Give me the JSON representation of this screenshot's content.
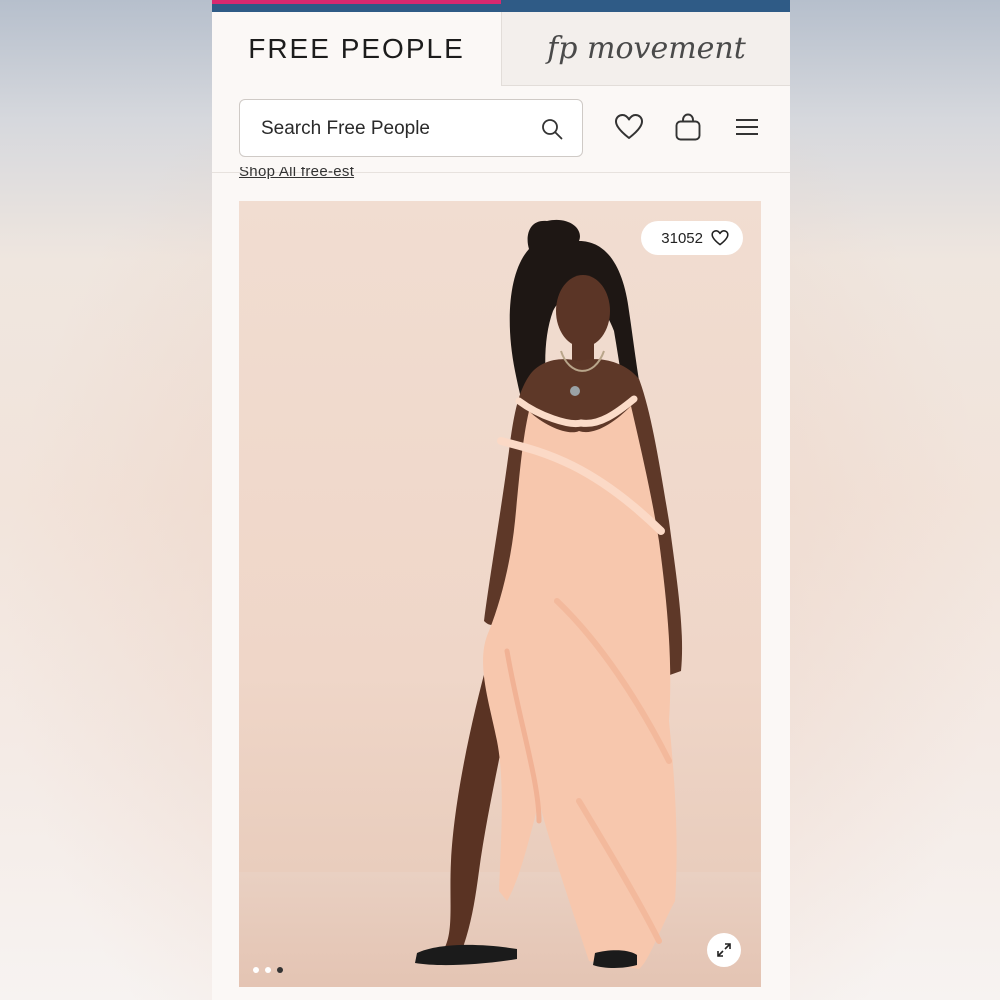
{
  "brand": {
    "free_people": "FREE PEOPLE",
    "fp_movement": "fp movement"
  },
  "header": {
    "search_placeholder": "Search Free People",
    "icons": [
      "search-icon",
      "heart-icon",
      "bag-icon",
      "menu-icon"
    ]
  },
  "shop_link": "Shop All free-est",
  "product": {
    "like_count": "31052",
    "carousel": {
      "total": 3,
      "active": 3
    }
  },
  "colors": {
    "topbar": "#2f5b86",
    "accent": "#d8296f"
  }
}
